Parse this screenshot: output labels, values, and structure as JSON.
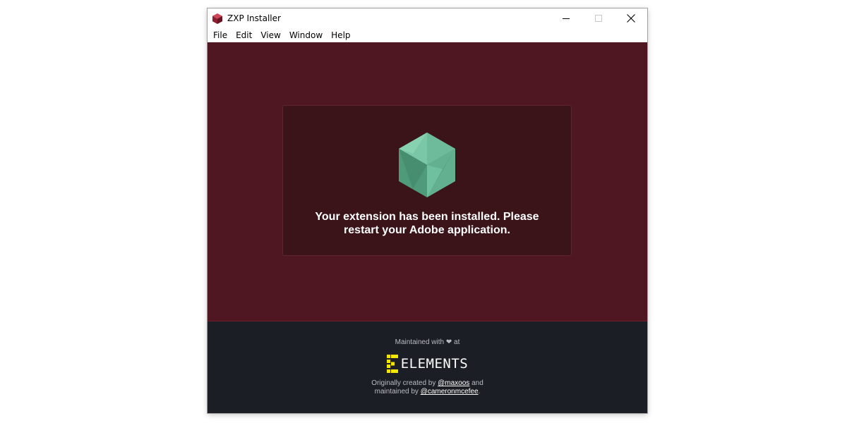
{
  "window": {
    "title": "ZXP Installer",
    "icon": "cube-app-icon",
    "controls": [
      "minimize",
      "maximize",
      "close"
    ]
  },
  "menu": {
    "items": [
      "File",
      "Edit",
      "View",
      "Window",
      "Help"
    ]
  },
  "main": {
    "icon": "green-cube-icon",
    "message": "Your extension has been installed. Please restart your Adobe application."
  },
  "footer": {
    "maintained_prefix": "Maintained with",
    "heart": "❤",
    "maintained_suffix": "at",
    "logo_text": "ELEMENTS",
    "credits_prefix": "Originally created by",
    "author1": "@maxoos",
    "credits_middle": "and",
    "credits_line2_prefix": "maintained by",
    "author2": "@cameronmcefee",
    "credits_end": "."
  },
  "colors": {
    "content_bg": "#4e1721",
    "card_bg": "#3b141a",
    "footer_bg": "#1b1e24",
    "cube_green": "#5fae8e",
    "logo_yellow": "#f2e600"
  }
}
